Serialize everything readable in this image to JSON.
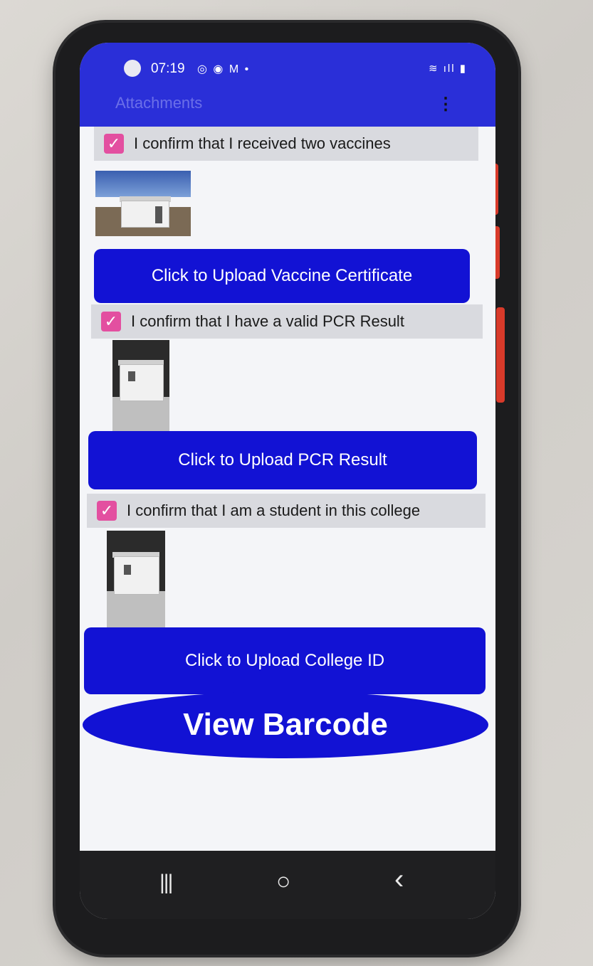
{
  "status_bar": {
    "time": "07:19",
    "notif_icons": "◎ ◉ M •",
    "system_icons": "≋ ıll ▮"
  },
  "app_bar": {
    "title": "Attachments",
    "menu_glyph": "⋮"
  },
  "sections": [
    {
      "confirm_label": "I confirm that I received two vaccines",
      "checked": true,
      "upload_label": "Click to Upload Vaccine Certificate"
    },
    {
      "confirm_label": "I confirm that I have a valid PCR Result",
      "checked": true,
      "upload_label": "Click to Upload PCR Result"
    },
    {
      "confirm_label": "I confirm that I am a student in this college",
      "checked": true,
      "upload_label": "Click to Upload College ID"
    }
  ],
  "barcode_button": "View Barcode",
  "nav": {
    "recents": "|||",
    "home": "○",
    "back": "‹"
  },
  "colors": {
    "app_bar": "#2a2fd8",
    "button": "#1212d4",
    "checkbox": "#e34fa0"
  }
}
